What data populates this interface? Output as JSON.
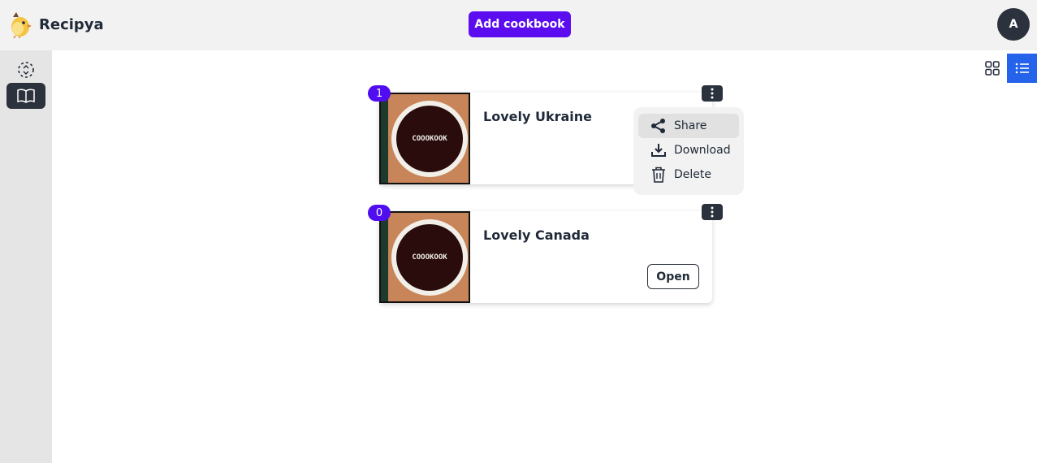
{
  "header": {
    "app_name": "Recipya",
    "add_button_label": "Add cookbook",
    "avatar_initial": "A"
  },
  "cookbooks": [
    {
      "title": "Lovely Ukraine",
      "count": "1",
      "cover_text": "COOOKOOK"
    },
    {
      "title": "Lovely Canada",
      "count": "0",
      "cover_text": "COOOKOOK",
      "open_label": "Open"
    }
  ],
  "context_menu": {
    "items": [
      {
        "label": "Share",
        "icon": "share-icon"
      },
      {
        "label": "Download",
        "icon": "download-icon"
      },
      {
        "label": "Delete",
        "icon": "trash-icon"
      }
    ]
  },
  "colors": {
    "accent": "#5b0df0",
    "view_active": "#2563eb",
    "dark": "#2b323d"
  }
}
